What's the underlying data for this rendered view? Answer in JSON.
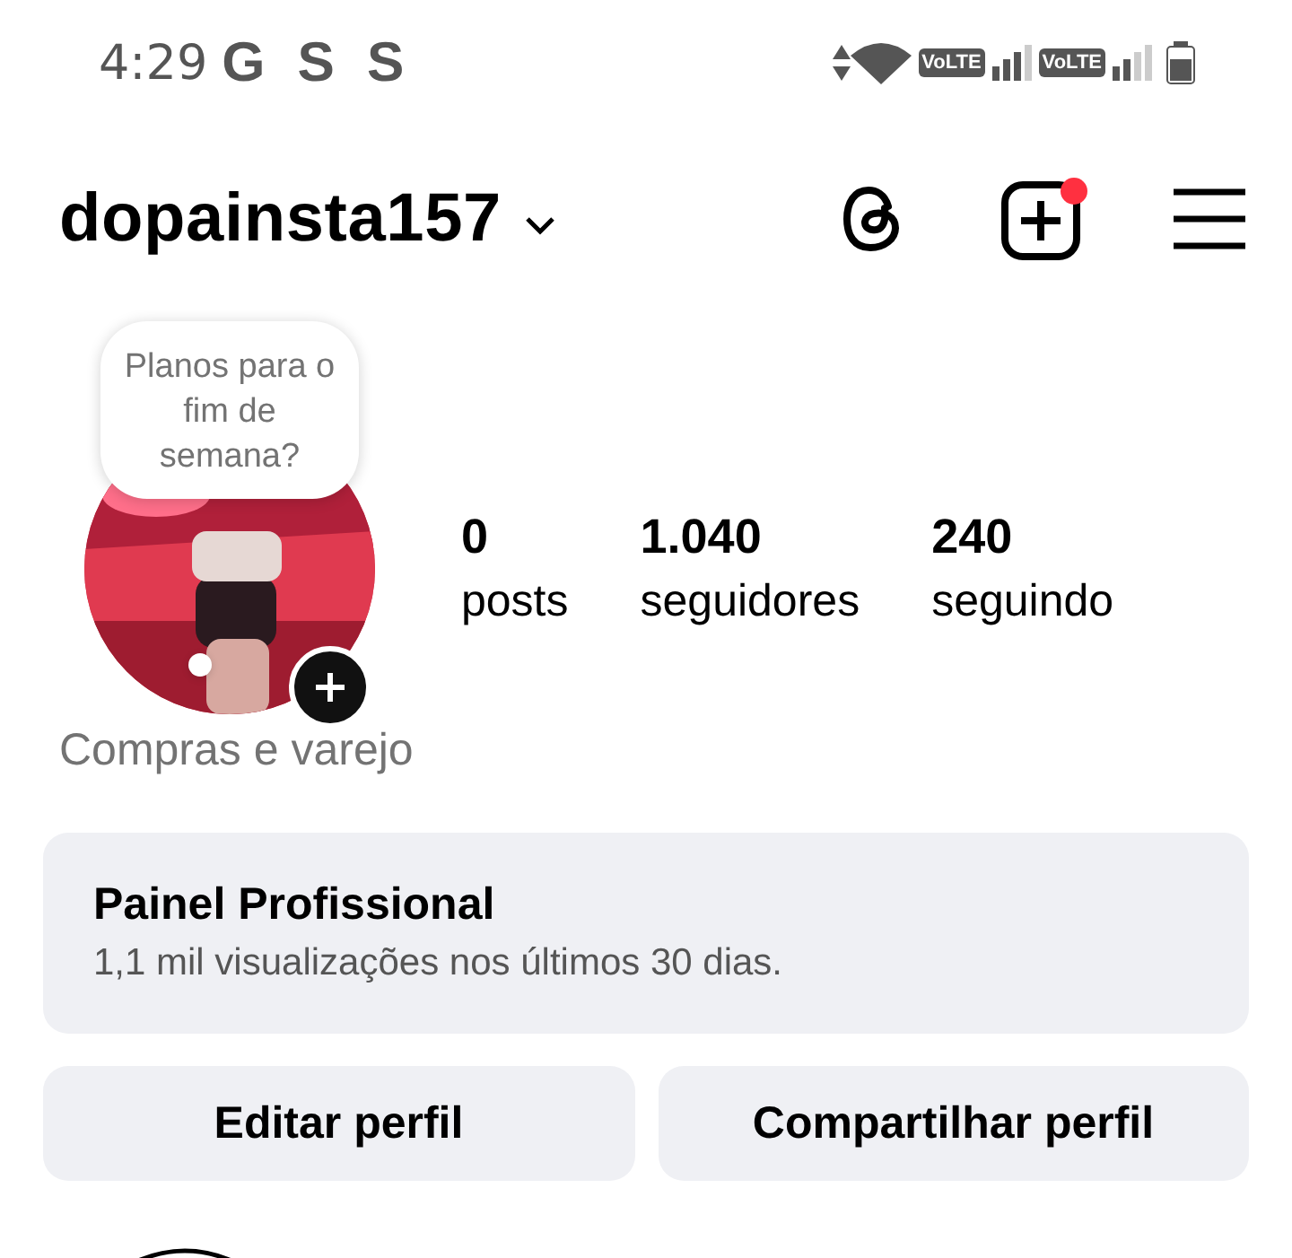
{
  "status_bar": {
    "time": "4:29",
    "notification_icons": [
      "G",
      "S",
      "S"
    ],
    "network_labels": [
      "VoLTE",
      "VoLTE"
    ]
  },
  "header": {
    "username": "dopainsta157",
    "new_post_badge": true
  },
  "profile": {
    "note": "Planos para o fim de semana?",
    "stats": [
      {
        "value": "0",
        "label": "posts"
      },
      {
        "value": "1.040",
        "label": "seguidores"
      },
      {
        "value": "240",
        "label": "seguindo"
      }
    ],
    "category": "Compras e varejo"
  },
  "dashboard": {
    "title": "Painel Profissional",
    "subtitle": "1,1 mil visualizações nos últimos 30 dias."
  },
  "buttons": [
    "Editar perfil",
    "Compartilhar perfil"
  ]
}
